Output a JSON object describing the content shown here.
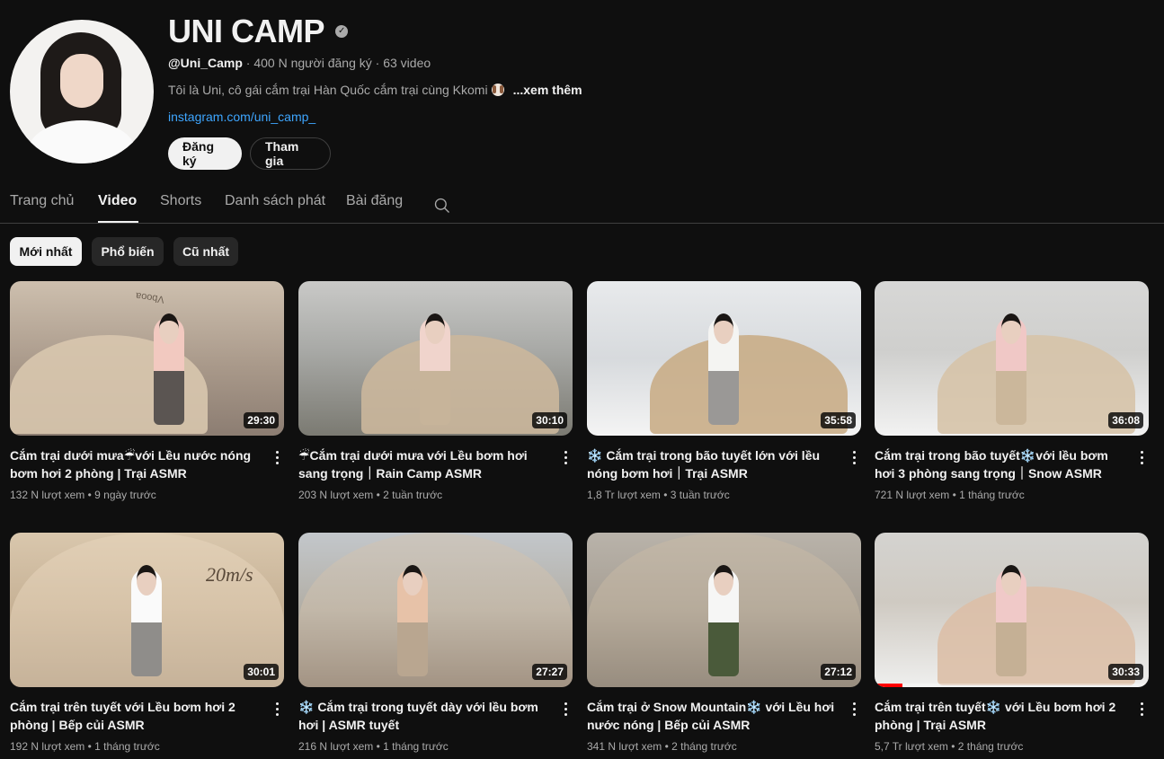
{
  "channel": {
    "name": "UNI CAMP",
    "handle": "@Uni_Camp",
    "subscribers": "400 N người đăng ký",
    "video_count": "63 video",
    "description": "Tôi là Uni, cô gái cắm trại Hàn Quốc cắm trại cùng Kkomi",
    "more": "...xem thêm",
    "link": "instagram.com/uni_camp_",
    "subscribe_label": "Đăng ký",
    "join_label": "Tham gia"
  },
  "tabs": [
    "Trang chủ",
    "Video",
    "Shorts",
    "Danh sách phát",
    "Bài đăng"
  ],
  "active_tab": "Video",
  "chips": [
    "Mới nhất",
    "Phổ biến",
    "Cũ nhất"
  ],
  "active_chip": "Mới nhất",
  "videos": [
    {
      "title": "Cắm trại dưới mưa☔với Lều nước nóng bơm hơi 2 phòng | Trại ASMR",
      "views": "132 N lượt xem",
      "age": "9 ngày trước",
      "duration": "29:30"
    },
    {
      "title": "☔Cắm trại dưới mưa với Lều bơm hơi sang trọng｜Rain Camp ASMR",
      "views": "203 N lượt xem",
      "age": "2 tuần trước",
      "duration": "30:10"
    },
    {
      "title": "❄️ Cắm trại trong bão tuyết lớn với lều nóng bơm hơi｜Trại ASMR",
      "views": "1,8 Tr lượt xem",
      "age": "3 tuần trước",
      "duration": "35:58"
    },
    {
      "title": "Cắm trại trong bão tuyết❄️với lều bơm hơi 3 phòng sang trọng｜Snow ASMR",
      "views": "721 N lượt xem",
      "age": "1 tháng trước",
      "duration": "36:08"
    },
    {
      "title": "Cắm trại trên tuyết với Lều bơm hơi 2 phòng | Bếp củi ASMR",
      "views": "192 N lượt xem",
      "age": "1 tháng trước",
      "duration": "30:01"
    },
    {
      "title": "❄️ Cắm trại trong tuyết dày với lều bơm hơi | ASMR tuyết",
      "views": "216 N lượt xem",
      "age": "1 tháng trước",
      "duration": "27:27"
    },
    {
      "title": "Cắm trại ở Snow Mountain❄️ với Lều hơi nước nóng | Bếp củi ASMR",
      "views": "341 N lượt xem",
      "age": "2 tháng trước",
      "duration": "27:12"
    },
    {
      "title": "Cắm trại trên tuyết❄️ với Lều bơm hơi 2 phòng | Trại ASMR",
      "views": "5,7 Tr lượt xem",
      "age": "2 tháng trước",
      "duration": "30:33",
      "watched_fraction": 0.1
    }
  ],
  "thumb_text": {
    "wind": "20m/s",
    "brand": "Vbooa"
  },
  "colors": {
    "background": "#0f0f0f",
    "link": "#3ea6ff",
    "progress": "#ff0000"
  },
  "icons": [
    "verified-icon",
    "search-icon",
    "more-vert-icon",
    "dog-emoji-icon"
  ]
}
